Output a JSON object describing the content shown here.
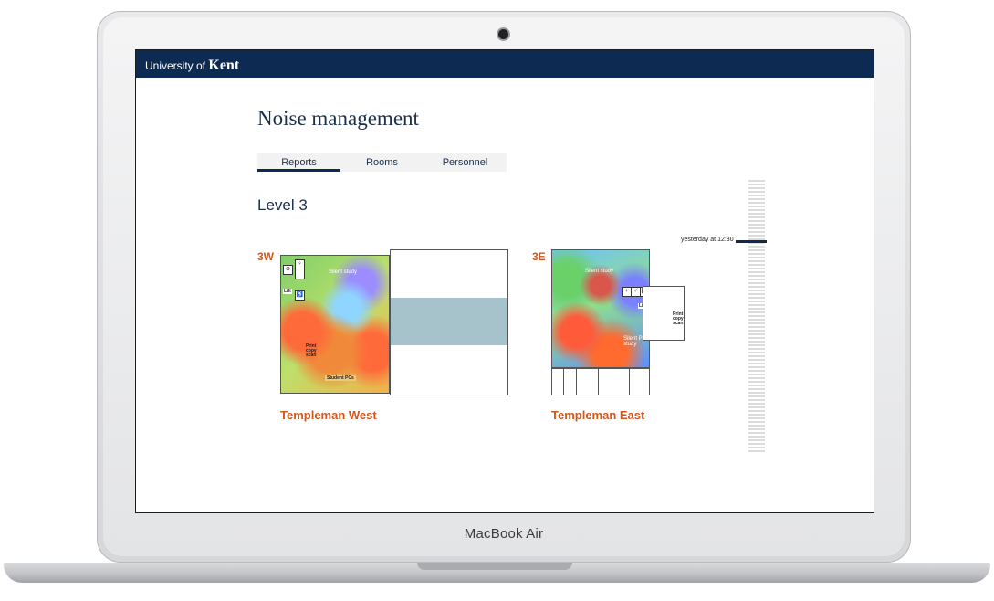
{
  "laptop": {
    "brand": "MacBook Air"
  },
  "header": {
    "logo_prefix": "University of",
    "logo_name": "Kent"
  },
  "page": {
    "title": "Noise management"
  },
  "tabs": [
    {
      "label": "Reports",
      "active": true
    },
    {
      "label": "Rooms",
      "active": false
    },
    {
      "label": "Personnel",
      "active": false
    }
  ],
  "level": {
    "title": "Level 3"
  },
  "plans": {
    "west": {
      "code": "3W",
      "name": "Templeman West",
      "labels": {
        "silent_study": "Silent study",
        "lift": "Lift",
        "print": "Print copy scan",
        "student_pcs": "Student PCs"
      }
    },
    "east": {
      "code": "3E",
      "name": "Templeman East",
      "labels": {
        "silent_study": "Silent study",
        "lift": "Lift",
        "print": "Print copy scan",
        "silent_pc": "Silent PC study"
      }
    }
  },
  "timeline": {
    "marker_label": "yesterday at 12:30"
  },
  "colors": {
    "navy": "#0d2b52",
    "orange": "#d2571c"
  }
}
